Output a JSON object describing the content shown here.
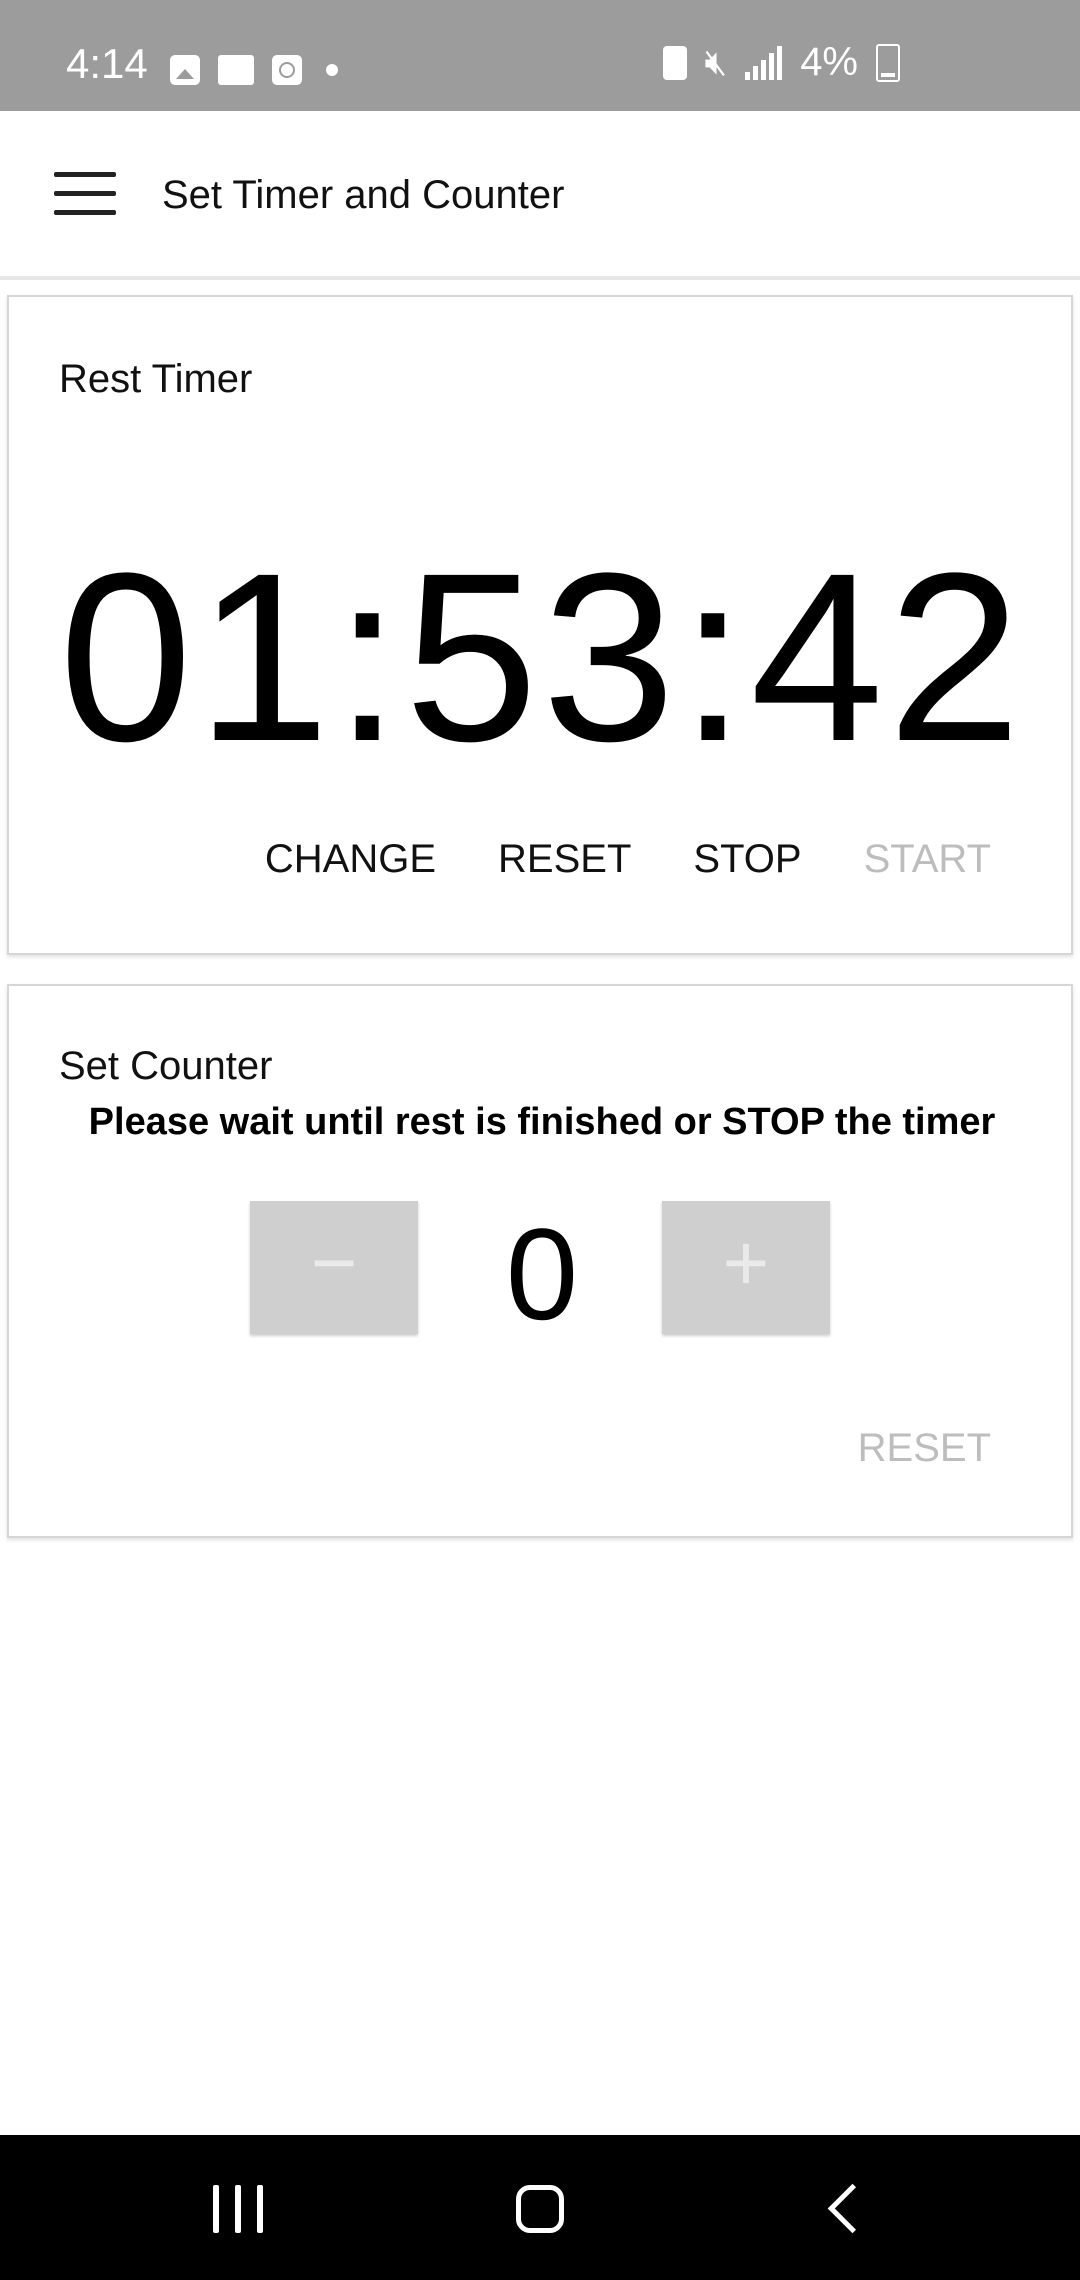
{
  "status_bar": {
    "time": "4:14",
    "battery": "4%",
    "icons_left": [
      "image-icon",
      "device-icon",
      "clock-icon",
      "dot-icon"
    ],
    "icons_right": [
      "recycle-icon",
      "mute-icon",
      "signal-icon",
      "battery-icon"
    ]
  },
  "app_bar": {
    "title": "Set Timer and Counter",
    "menu_icon": "hamburger-menu-icon"
  },
  "timer_card": {
    "title": "Rest Timer",
    "display": "01:53:42",
    "buttons": {
      "change": "CHANGE",
      "reset": "RESET",
      "stop": "STOP",
      "start": "START"
    }
  },
  "counter_card": {
    "title": "Set Counter",
    "message": "Please wait until rest is finished or STOP the timer",
    "value": "0",
    "minus_glyph": "−",
    "plus_glyph": "+",
    "reset": "RESET"
  },
  "colors": {
    "status_bar_bg": "#9c9c9c",
    "disabled_text": "#bdbdbd",
    "counter_button_bg": "#cfcfcf",
    "nav_bar_bg": "#000000"
  }
}
